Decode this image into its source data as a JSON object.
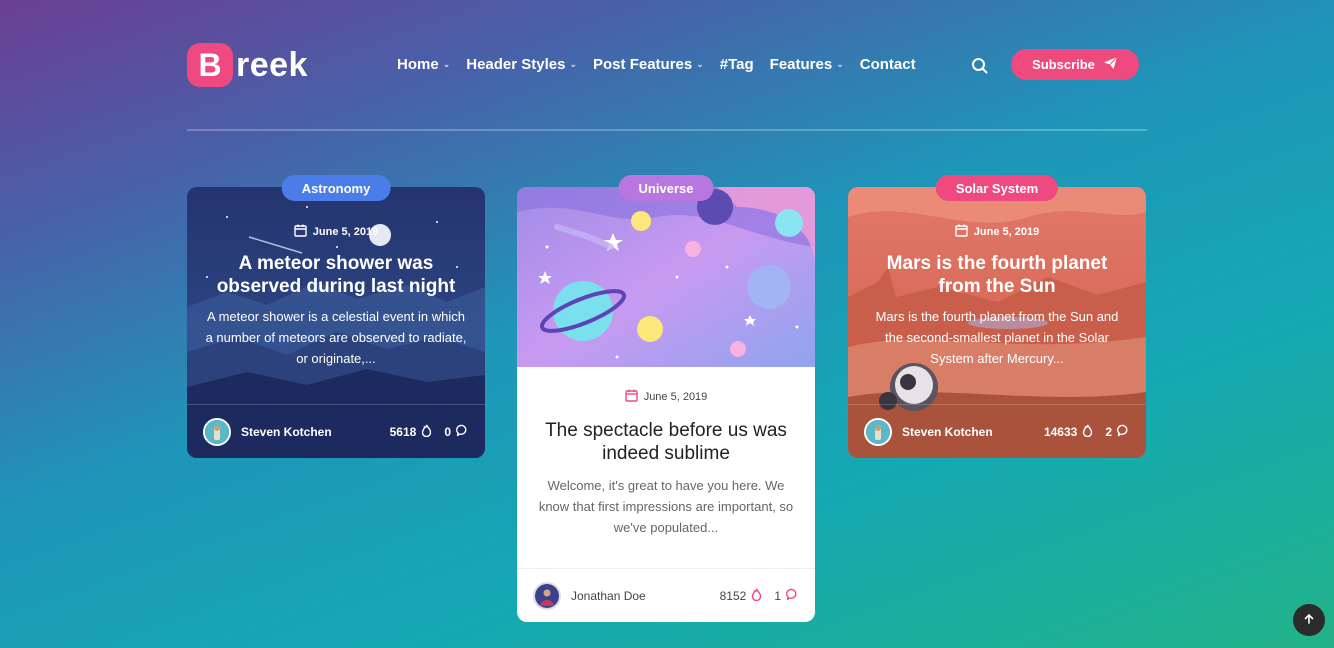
{
  "brand": {
    "badge_letter": "B",
    "rest": "reek",
    "accent": "#ef4a7f"
  },
  "nav": [
    {
      "label": "Home",
      "has_dropdown": true
    },
    {
      "label": "Header Styles",
      "has_dropdown": true
    },
    {
      "label": "Post Features",
      "has_dropdown": true
    },
    {
      "label": "#Tag",
      "has_dropdown": false
    },
    {
      "label": "Features",
      "has_dropdown": true
    },
    {
      "label": "Contact",
      "has_dropdown": false
    }
  ],
  "search_icon": "search-icon",
  "subscribe": {
    "label": "Subscribe",
    "icon": "paper-plane-icon"
  },
  "cards": [
    {
      "category": "Astronomy",
      "category_color": "#4a7de8",
      "date": "June 5, 2019",
      "title": "A meteor shower was observed during last night",
      "excerpt": "A meteor shower is a celestial event in which a number of meteors are observed to radiate, or originate,...",
      "author": "Steven Kotchen",
      "views": "5618",
      "comments": "0"
    },
    {
      "category": "Universe",
      "category_color": "#b877e0",
      "date": "June 5, 2019",
      "title": "The spectacle before us was indeed sublime",
      "excerpt": "Welcome, it's great to have you here. We know that first impressions are important, so we've populated...",
      "author": "Jonathan Doe",
      "views": "8152",
      "comments": "1"
    },
    {
      "category": "Solar System",
      "category_color": "#ef4a7f",
      "date": "June 5, 2019",
      "title": "Mars is the fourth planet from the Sun",
      "excerpt": "Mars is the fourth planet from the Sun and the second-smallest planet in the Solar System after Mercury...",
      "author": "Steven Kotchen",
      "views": "14633",
      "comments": "2"
    }
  ],
  "scroll_top_icon": "arrow-up-icon"
}
